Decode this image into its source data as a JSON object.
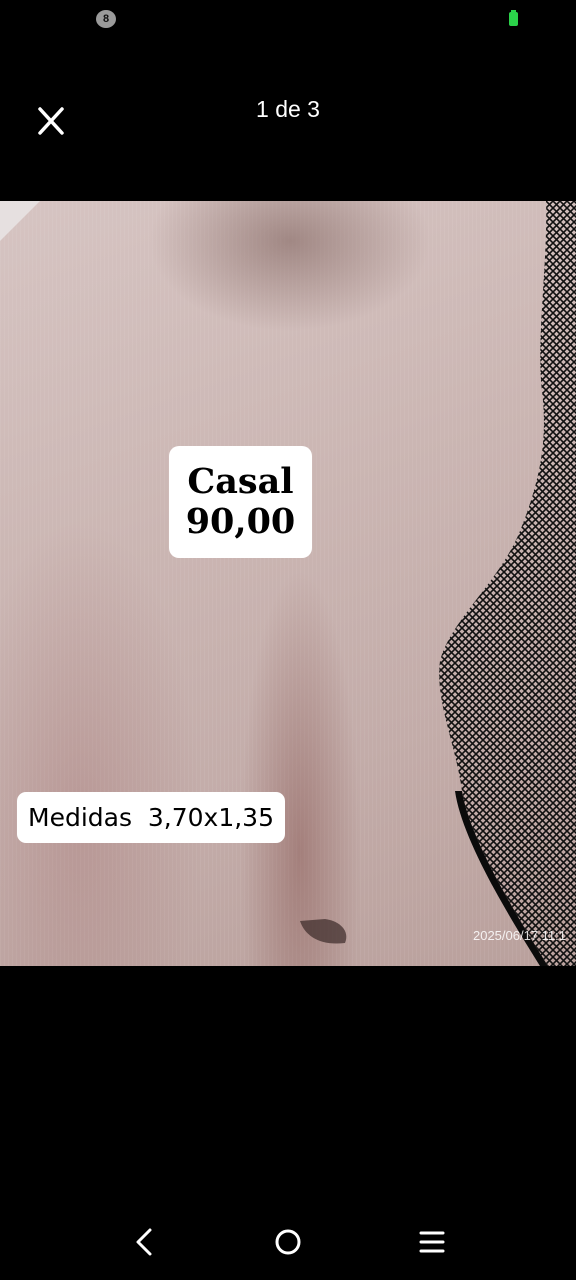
{
  "status_bar": {
    "notification_count": "8",
    "notification_icon": "chat-bubble-icon",
    "battery_icon": "battery-icon",
    "battery_color": "#2bd24a"
  },
  "viewer": {
    "close_icon": "close-icon",
    "counter": "1 de 3"
  },
  "photo": {
    "price_label": "Casal",
    "price_value": "90,00",
    "size_label": "Medidas  3,70x1,35",
    "timestamp": "2025/06/17 11:1"
  },
  "nav_bar": {
    "back_icon": "back-chevron-icon",
    "home_icon": "home-circle-icon",
    "recents_icon": "recents-lines-icon"
  }
}
